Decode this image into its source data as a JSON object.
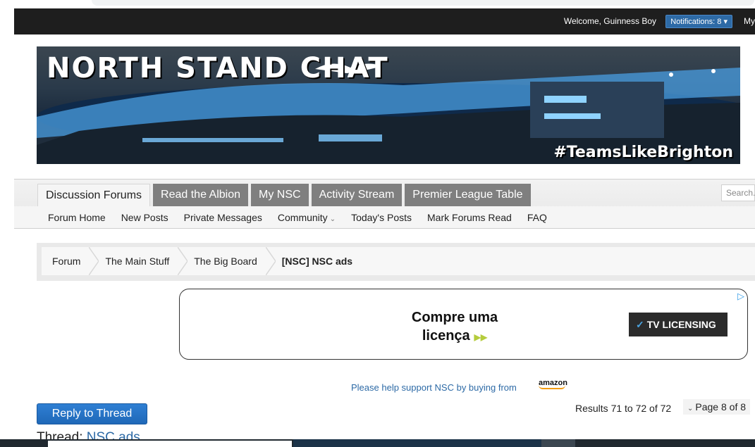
{
  "topbar": {
    "welcome": "Welcome,  Guinness Boy",
    "notifications": "Notifications: 8",
    "my": "My"
  },
  "banner": {
    "title": "NORTH STAND CHAT",
    "hashtag": "#TeamsLikeBrighton"
  },
  "nav": {
    "tabs": [
      "Discussion Forums",
      "Read the Albion",
      "My NSC",
      "Activity Stream",
      "Premier League Table"
    ],
    "search_placeholder": "Search.",
    "subnav": [
      "Forum Home",
      "New Posts",
      "Private Messages",
      "Community",
      "Today's Posts",
      "Mark Forums Read",
      "FAQ"
    ]
  },
  "breadcrumb": [
    "Forum",
    "The Main Stuff",
    "The Big Board",
    "[NSC] NSC ads"
  ],
  "ad": {
    "line1": "Compre uma",
    "line2": "licença",
    "brand": "TV LICENSING"
  },
  "support": {
    "text": "Please help support NSC by buying from",
    "amazon": "amazon"
  },
  "thread": {
    "reply_button": "Reply to Thread",
    "results": "Results 71 to 72 of 72",
    "pager": "Page 8 of 8",
    "title_prefix": "Thread: ",
    "title_link": "NSC ads"
  }
}
